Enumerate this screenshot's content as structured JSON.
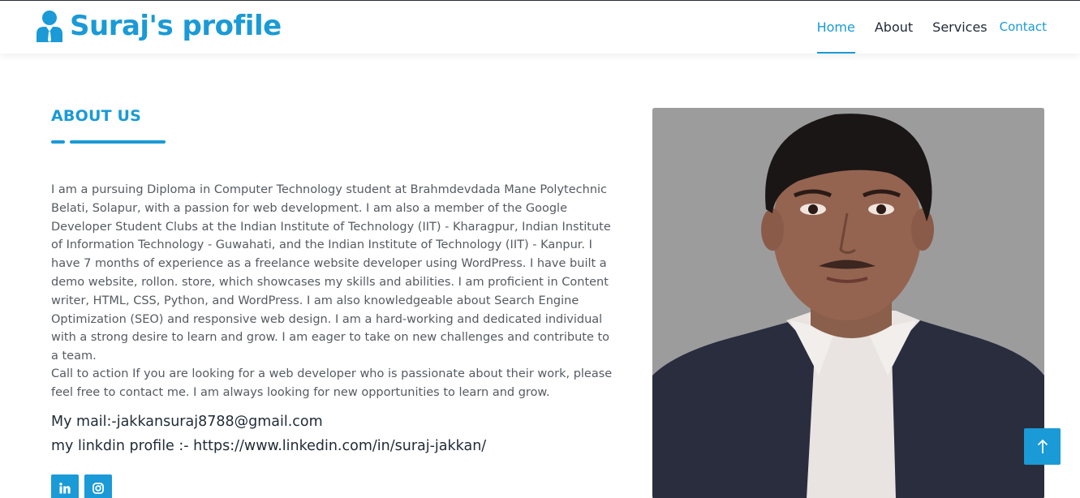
{
  "header": {
    "brand": "Suraj's profile",
    "nav": [
      {
        "label": "Home",
        "active": true
      },
      {
        "label": "About",
        "active": false
      },
      {
        "label": "Services",
        "active": false
      },
      {
        "label": "Contact",
        "active": false
      }
    ]
  },
  "about": {
    "title": "ABOUT US",
    "paragraph1": "I am a pursuing Diploma in Computer Technology student at Brahmdevdada Mane Polytechnic Belati, Solapur, with a passion for web development. I am also a member of the Google Developer Student Clubs at the Indian Institute of Technology (IIT) - Kharagpur, Indian Institute of Information Technology - Guwahati, and the Indian Institute of Technology (IIT) - Kanpur. I have 7 months of experience as a freelance website developer using WordPress. I have built a demo website, rollon. store, which showcases my skills and abilities. I am proficient in Content writer, HTML, CSS, Python, and WordPress. I am also knowledgeable about Search Engine Optimization (SEO) and responsive web design. I am a hard-working and dedicated individual with a strong desire to learn and grow. I am eager to take on new challenges and contribute to a team.",
    "paragraph2": "Call to action If you are looking for a web developer who is passionate about their work, please feel free to contact me. I am always looking for new opportunities to learn and grow.",
    "mail": "My mail:-jakkansuraj8788@gmail.com",
    "linkedin": "my linkdin profile :- https://www.linkedin.com/in/suraj-jakkan/"
  },
  "social": [
    "linkedin-icon",
    "instagram-icon"
  ],
  "colors": {
    "accent": "#1a9ad6",
    "text": "#555b62",
    "dark": "#1f2a36"
  },
  "scroll_top_icon": "arrow-up-icon"
}
